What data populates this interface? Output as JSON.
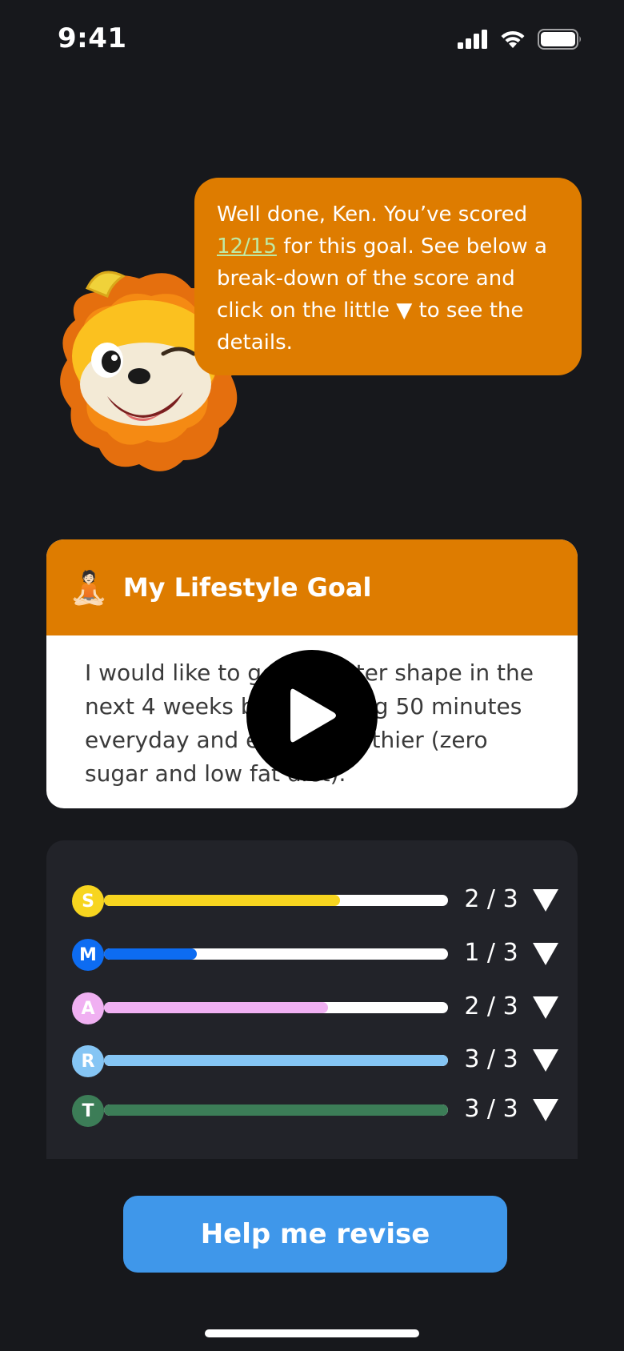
{
  "status_bar": {
    "time": "9:41"
  },
  "bubble": {
    "text_before": "Well done, Ken. You’ve scored ",
    "score": "12/15",
    "text_after": " for this goal. See below a break-down of the score and click on the little ▼ to see the details."
  },
  "goal": {
    "emoji": "🧘🏻",
    "title": "My Lifestyle Goal",
    "text": "I would like to get in better shape in the next 4 weeks by exercising 50 minutes everyday and eating healthier (zero sugar and low fat diet)."
  },
  "scores": [
    {
      "letter": "S",
      "value": "2 / 3",
      "fraction": 0.685,
      "color": "#f7d51f"
    },
    {
      "letter": "M",
      "value": "1 / 3",
      "fraction": 0.27,
      "color": "#0d6cf2"
    },
    {
      "letter": "A",
      "value": "2 / 3",
      "fraction": 0.65,
      "color": "#f0b0f2"
    },
    {
      "letter": "R",
      "value": "3 / 3",
      "fraction": 1.0,
      "color": "#85c5f4"
    },
    {
      "letter": "T",
      "value": "3 / 3",
      "fraction": 1.0,
      "color": "#3c7d57"
    }
  ],
  "toggle_icon": "triangle-down-icon",
  "revise_button": {
    "label": "Help me revise"
  },
  "colors": {
    "background": "#17181c",
    "accent": "#de7c00",
    "button": "#3f97ea",
    "panel": "#222329"
  }
}
